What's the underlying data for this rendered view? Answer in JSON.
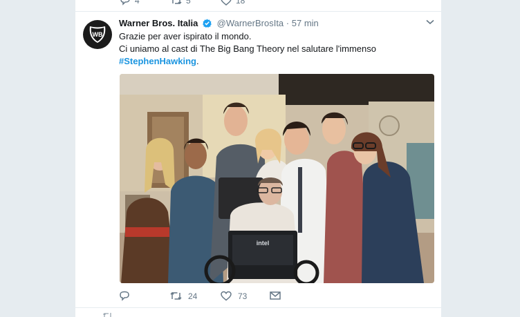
{
  "prev_tweet": {
    "replies": "4",
    "retweets": "5",
    "likes": "18"
  },
  "tweet": {
    "author_name": "Warner Bros. Italia",
    "handle": "@WarnerBrosIta",
    "separator": "·",
    "time": "57 min",
    "text_line1": "Grazie per aver ispirato il mondo.",
    "text_line2": "Ci uniamo al cast di The Big Bang Theory nel salutare l'immenso",
    "hashtag": "#StephenHawking",
    "text_end": ".",
    "replies": "",
    "retweets": "24",
    "likes": "73"
  },
  "colors": {
    "page_background": "#e6ecf0",
    "link": "#1b95e0",
    "verified": "#1da1f2",
    "muted": "#657786"
  },
  "icons": {
    "avatar": "warner-bros-shield-logo",
    "verified": "verified-badge-icon",
    "caret": "chevron-down-icon",
    "reply": "reply-icon",
    "retweet": "retweet-icon",
    "like": "heart-icon",
    "dm": "envelope-icon"
  }
}
